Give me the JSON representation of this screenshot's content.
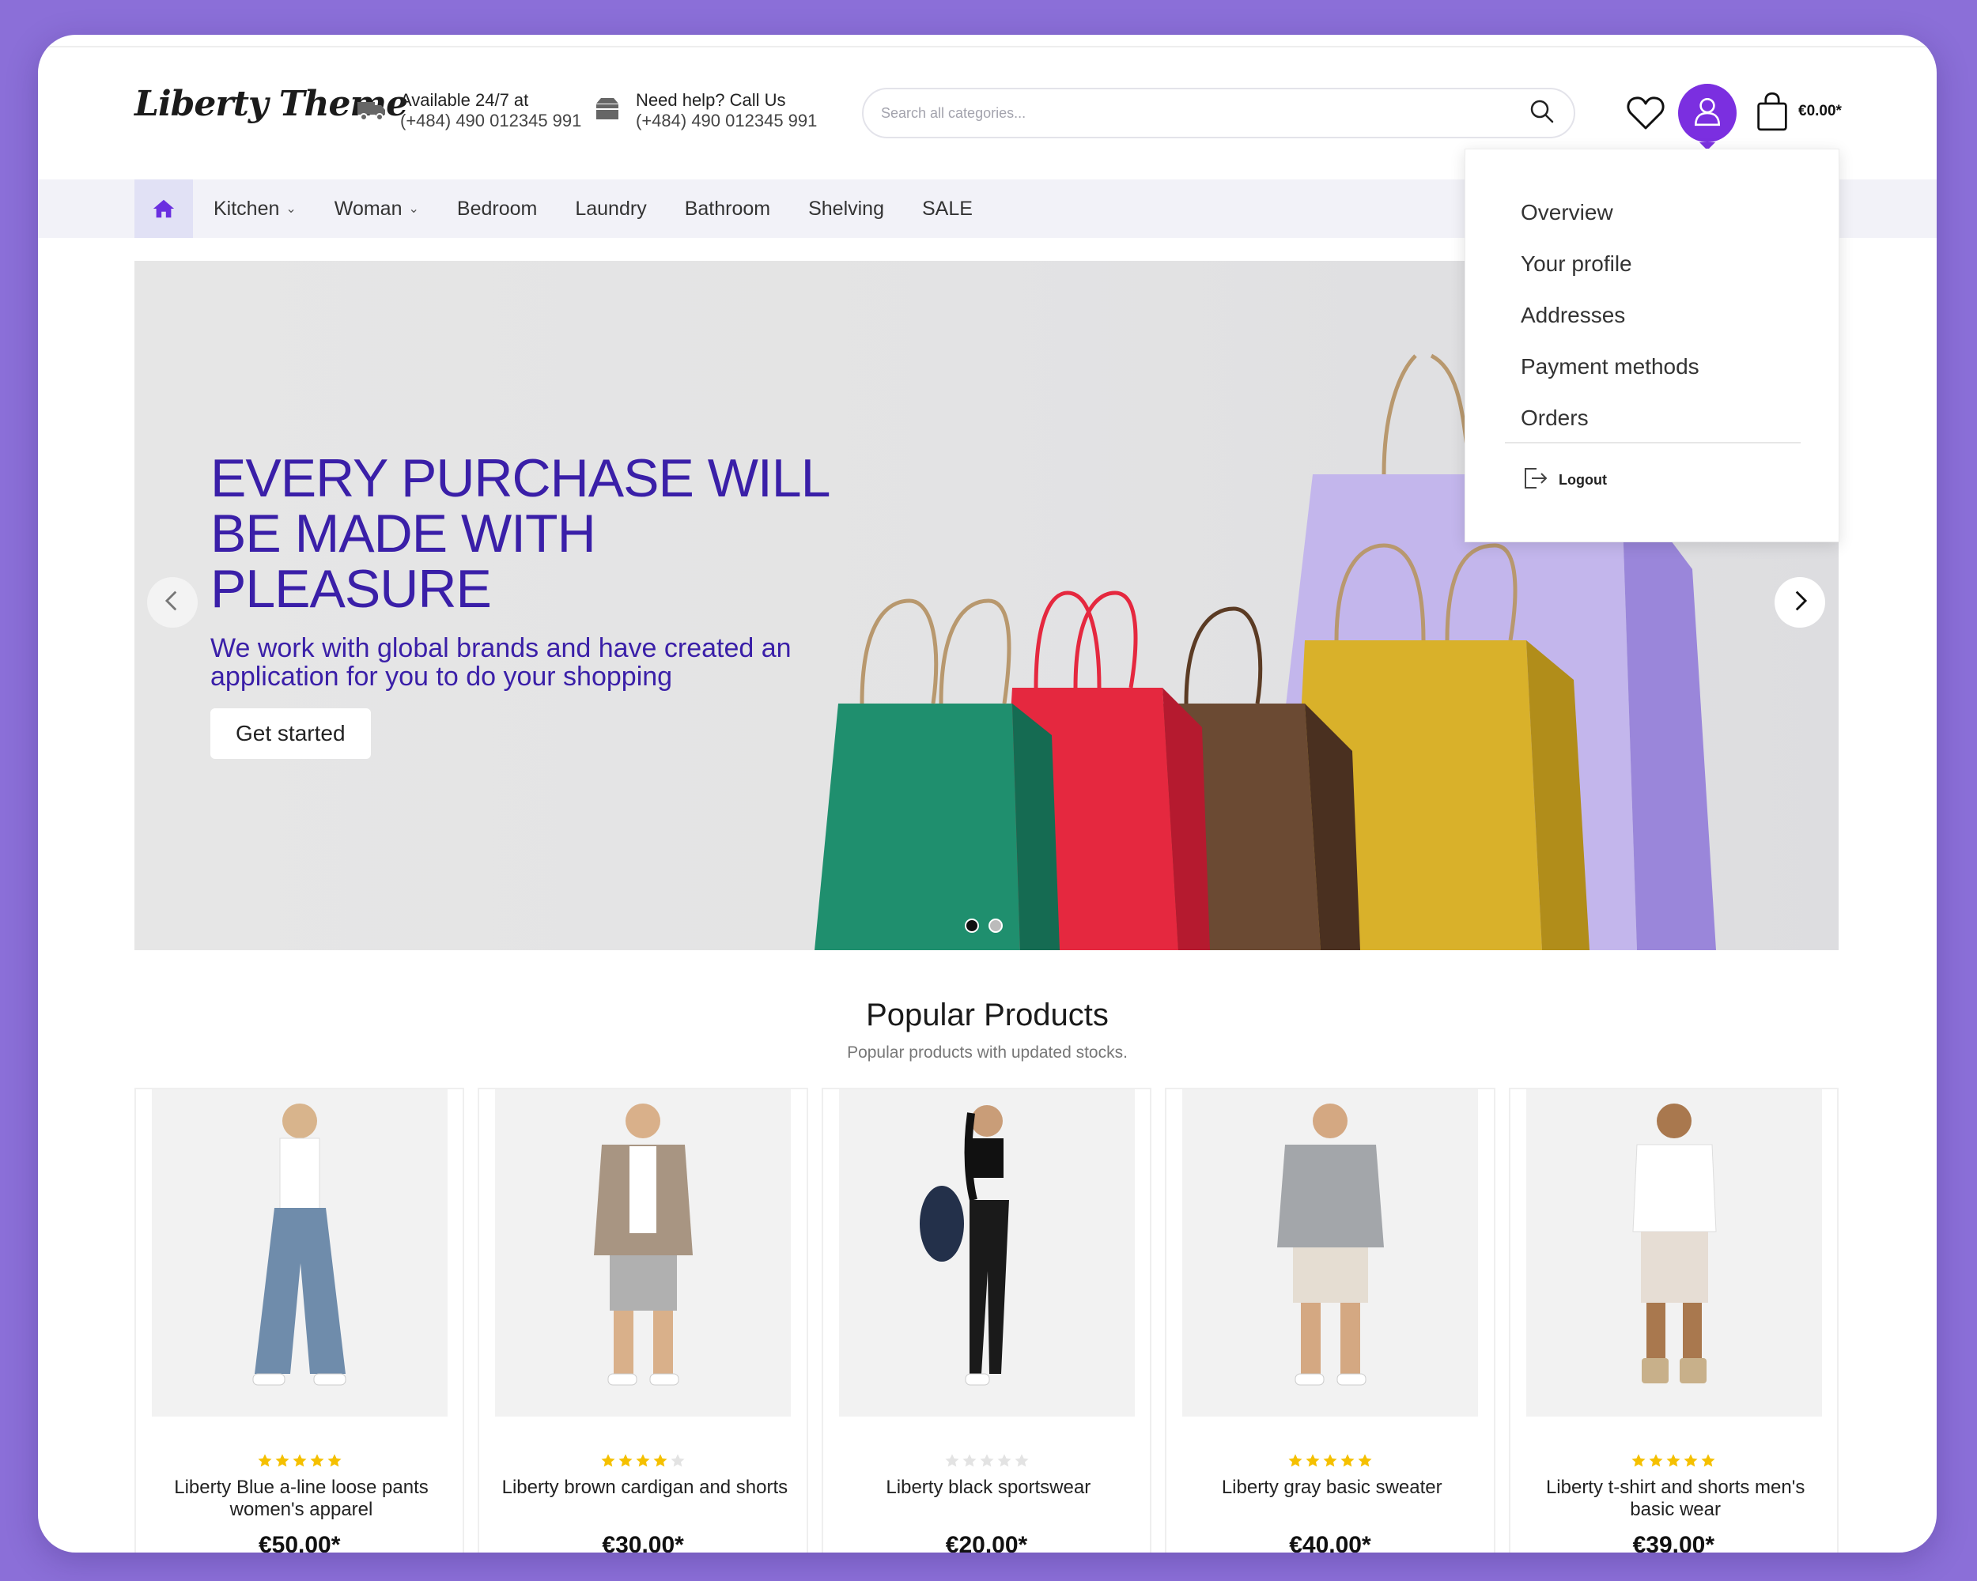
{
  "brand": {
    "logo": "Liberty Theme",
    "accent": "#7b2fe0",
    "hero_color": "#3a1fa8"
  },
  "header": {
    "info1": {
      "icon": "truck-icon",
      "line1": "Available 24/7 at",
      "line2": "(+484) 490 012345 991"
    },
    "info2": {
      "icon": "box-icon",
      "line1": "Need help? Call Us",
      "line2": "(+484) 490 012345 991"
    },
    "search": {
      "placeholder": "Search all categories...",
      "value": ""
    },
    "cart_total": "€0.00*"
  },
  "nav": {
    "items": [
      {
        "label": "Kitchen",
        "has_dropdown": true
      },
      {
        "label": "Woman",
        "has_dropdown": true
      },
      {
        "label": "Bedroom",
        "has_dropdown": false
      },
      {
        "label": "Laundry",
        "has_dropdown": false
      },
      {
        "label": "Bathroom",
        "has_dropdown": false
      },
      {
        "label": "Shelving",
        "has_dropdown": false
      },
      {
        "label": "SALE",
        "has_dropdown": false
      }
    ]
  },
  "hero": {
    "title": "EVERY PURCHASE WILL BE MADE WITH PLEASURE",
    "subtitle": "We work with global brands and have created an application for you to do your shopping",
    "button": "Get started",
    "slides": 2,
    "active_slide": 1
  },
  "account_menu": {
    "items": [
      "Overview",
      "Your profile",
      "Addresses",
      "Payment methods",
      "Orders"
    ],
    "logout": "Logout"
  },
  "popular": {
    "title": "Popular Products",
    "subtitle": "Popular products with updated stocks.",
    "products": [
      {
        "name": "Liberty Blue a-line loose pants women's apparel",
        "rating": 5,
        "price": "€50.00*"
      },
      {
        "name": "Liberty brown cardigan and shorts",
        "rating": 4,
        "price": "€30.00*"
      },
      {
        "name": "Liberty black sportswear",
        "rating": 0,
        "price": "€20.00*"
      },
      {
        "name": "Liberty gray basic sweater",
        "rating": 5,
        "price": "€40.00*"
      },
      {
        "name": "Liberty t-shirt and shorts men's basic wear",
        "rating": 5,
        "price": "€39.00*"
      }
    ]
  }
}
